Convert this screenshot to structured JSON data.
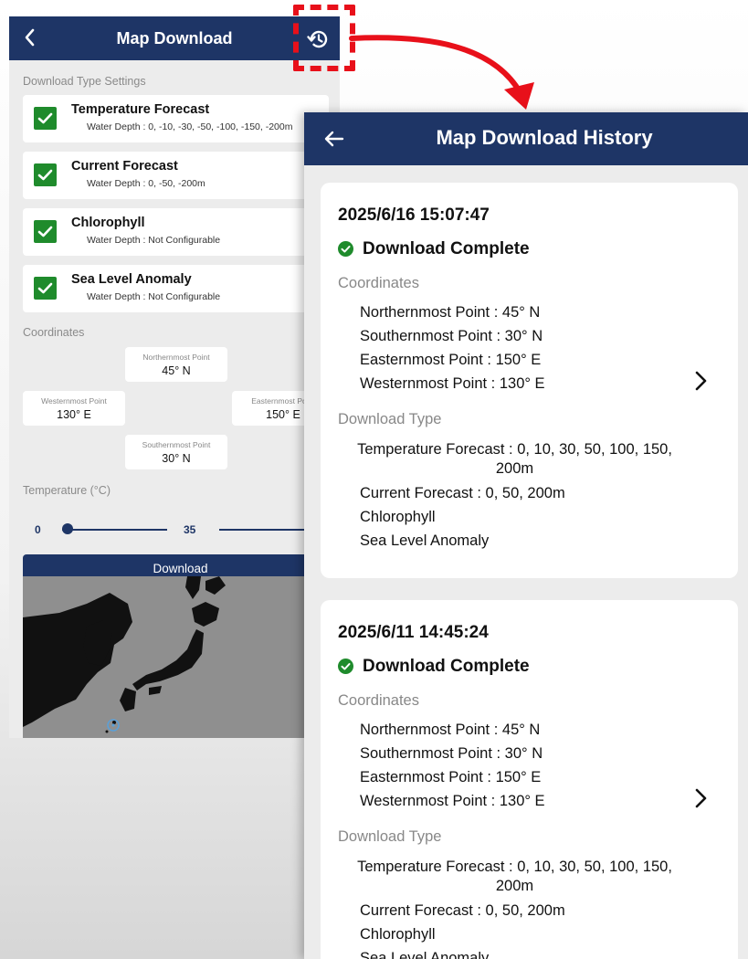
{
  "left_screen": {
    "title": "Map Download",
    "section_download_type": "Download Type Settings",
    "types": [
      {
        "name": "Temperature Forecast",
        "depth": "Water Depth : 0, -10, -30, -50, -100, -150, -200m",
        "checked": true
      },
      {
        "name": "Current Forecast",
        "depth": "Water Depth : 0, -50, -200m",
        "checked": true
      },
      {
        "name": "Chlorophyll",
        "depth": "Water Depth : Not Configurable",
        "checked": true
      },
      {
        "name": "Sea Level Anomaly",
        "depth": "Water Depth : Not Configurable",
        "checked": true
      }
    ],
    "section_coordinates": "Coordinates",
    "coordinates": {
      "north": {
        "label": "Northernmost Point",
        "value": "45° N"
      },
      "west": {
        "label": "Westernmost Point",
        "value": "130° E"
      },
      "east": {
        "label": "Easternmost Point",
        "value": "150° E"
      },
      "south": {
        "label": "Southernmost Point",
        "value": "30° N"
      }
    },
    "temperature_label": "Temperature (°C)",
    "slider_min": "0",
    "slider_max": "35",
    "download_button": "Download"
  },
  "right_screen": {
    "title": "Map Download History",
    "records": [
      {
        "timestamp": "2025/6/16 15:07:47",
        "status": "Download Complete",
        "coordinates_label": "Coordinates",
        "coordinates": [
          "Northernmost Point : 45° N",
          "Southernmost Point : 30° N",
          "Easternmost Point : 150° E",
          "Westernmost Point : 130° E"
        ],
        "download_type_label": "Download Type",
        "temperature_line": "Temperature Forecast : 0, 10, 30, 50, 100, 150, 200m",
        "types": [
          "Current Forecast : 0, 50, 200m",
          "Chlorophyll",
          "Sea Level Anomaly"
        ]
      },
      {
        "timestamp": "2025/6/11 14:45:24",
        "status": "Download Complete",
        "coordinates_label": "Coordinates",
        "coordinates": [
          "Northernmost Point : 45° N",
          "Southernmost Point : 30° N",
          "Easternmost Point : 150° E",
          "Westernmost Point : 130° E"
        ],
        "download_type_label": "Download Type",
        "temperature_line": "Temperature Forecast : 0, 10, 30, 50, 100, 150, 200m",
        "types": [
          "Current Forecast : 0, 50, 200m",
          "Chlorophyll",
          "Sea Level Anomaly"
        ]
      }
    ]
  },
  "colors": {
    "header": "#1e3566",
    "checkbox": "#1f8b2c",
    "highlight": "#e8101a",
    "status_icon": "#1f8b2c"
  },
  "icons": {
    "back": "chevron-left-icon",
    "history": "history-icon",
    "back_arrow": "arrow-left-icon",
    "status": "check-circle-icon",
    "detail": "chevron-right-icon"
  }
}
